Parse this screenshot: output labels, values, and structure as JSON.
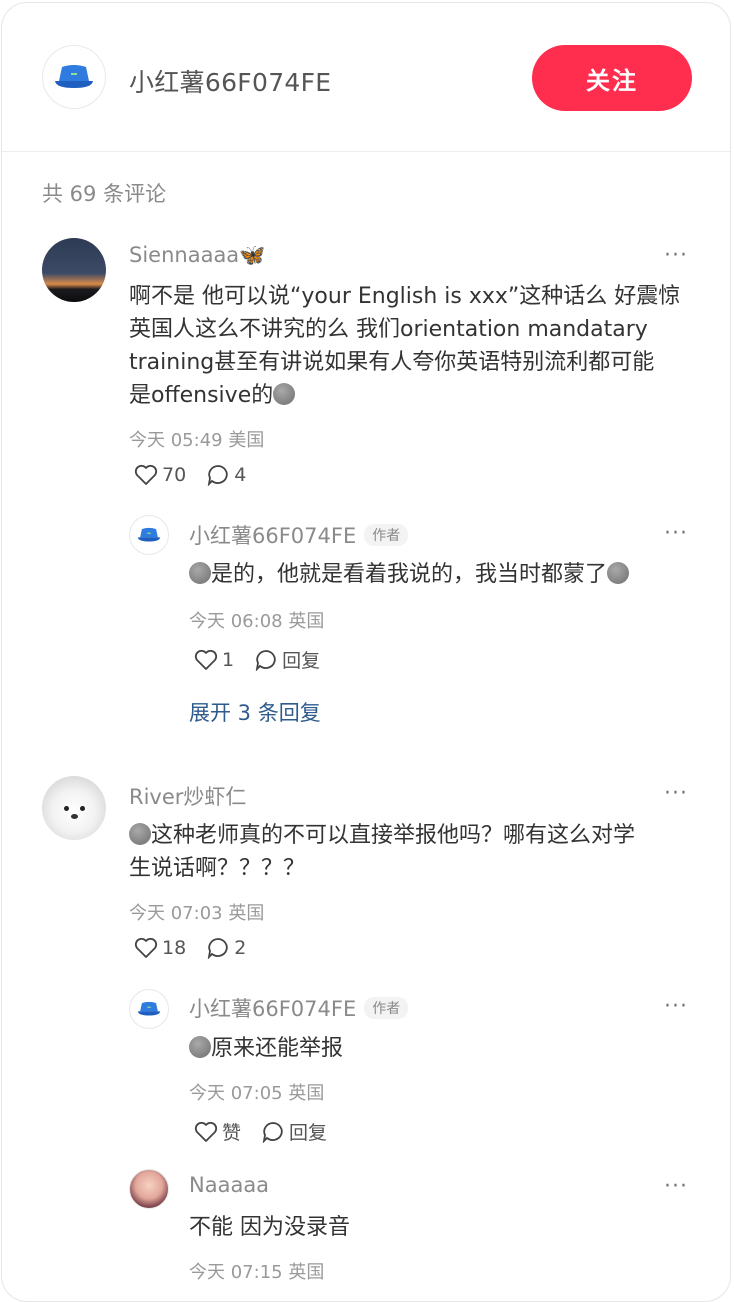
{
  "header": {
    "author_name": "小红薯66F074FE",
    "follow_label": "关注",
    "comment_count": "共 69 条评论"
  },
  "comments": [
    {
      "user": "Siennaaaa🦋",
      "text": [
        "啊不是 他可以说“your English is xxx”这种话么 好震惊",
        "英国人这么不讲究的么 我们orientation mandatary",
        "training甚至有讲说如果有人夸你英语特别流利都可能",
        "是offensive的"
      ],
      "meta": "今天 05:49 美国",
      "likes": "70",
      "replies": "4",
      "reply": {
        "user": "小红薯66F074FE",
        "tag": "作者",
        "text": "是的，他就是看着我说的，我当时都蒙了",
        "meta": "今天 06:08 英国",
        "likes": "1",
        "reply_label": "回复"
      },
      "expand": "展开 3 条回复"
    },
    {
      "user": "River炒虾仁",
      "text": [
        "这种老师真的不可以直接举报他吗？哪有这么对学",
        "生说话啊？？？？"
      ],
      "meta": "今天 07:03 英国",
      "likes": "18",
      "replies": "2",
      "reply": {
        "user": "小红薯66F074FE",
        "tag": "作者",
        "text": "原来还能举报",
        "meta": "今天 07:05 英国",
        "likes": "赞",
        "reply_label": "回复"
      },
      "reply2": {
        "user": "Naaaaa",
        "text": "不能 因为没录音",
        "meta": "今天 07:15 英国"
      }
    }
  ],
  "icons": {
    "more": "more-icon",
    "heart": "heart-icon",
    "comment": "comment-icon",
    "hat": "bucket-hat-avatar"
  },
  "colors": {
    "accent": "#ff2e4f",
    "link": "#2e5a8c"
  }
}
